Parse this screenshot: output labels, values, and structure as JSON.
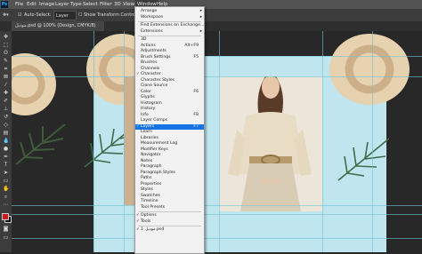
{
  "menubar": {
    "items": [
      "File",
      "Edit",
      "Image",
      "Layer",
      "Type",
      "Select",
      "Filter",
      "3D",
      "View",
      "Window",
      "Help"
    ],
    "active": "Window"
  },
  "options": {
    "auto_select": "Auto-Select:",
    "layer_select": "Layer",
    "show_transform": "Show Transform Controls"
  },
  "document_tab": {
    "title": "موديل.psd @ 100% (Design, CMYK/8)"
  },
  "window_menu": {
    "items": [
      {
        "label": "Arrange",
        "submenu": true
      },
      {
        "label": "Workspace",
        "submenu": true
      },
      {
        "sep": true
      },
      {
        "label": "Find Extensions on Exchange..."
      },
      {
        "label": "Extensions",
        "submenu": true
      },
      {
        "sep": true
      },
      {
        "label": "3D"
      },
      {
        "label": "Actions",
        "shortcut": "Alt+F9"
      },
      {
        "label": "Adjustments"
      },
      {
        "label": "Brush Settings",
        "shortcut": "F5"
      },
      {
        "label": "Brushes"
      },
      {
        "label": "Channels"
      },
      {
        "label": "Character",
        "checked": true
      },
      {
        "label": "Character Styles"
      },
      {
        "label": "Clone Source"
      },
      {
        "label": "Color",
        "shortcut": "F6"
      },
      {
        "label": "Glyphs"
      },
      {
        "label": "Histogram"
      },
      {
        "label": "History"
      },
      {
        "label": "Info",
        "shortcut": "F8"
      },
      {
        "label": "Layer Comps"
      },
      {
        "label": "Layers",
        "shortcut": "F7",
        "checked": true,
        "highlighted": true
      },
      {
        "label": "Learn"
      },
      {
        "label": "Libraries"
      },
      {
        "label": "Measurement Log"
      },
      {
        "label": "Modifier Keys"
      },
      {
        "label": "Navigator"
      },
      {
        "label": "Notes"
      },
      {
        "label": "Paragraph"
      },
      {
        "label": "Paragraph Styles"
      },
      {
        "label": "Paths"
      },
      {
        "label": "Properties"
      },
      {
        "label": "Styles"
      },
      {
        "label": "Swatches"
      },
      {
        "label": "Timeline"
      },
      {
        "label": "Tool Presets"
      },
      {
        "sep": true
      },
      {
        "label": "Options",
        "checked": true
      },
      {
        "label": "Tools",
        "checked": true
      },
      {
        "sep": true
      },
      {
        "label": "موديل.psd",
        "checked": true,
        "prefix": "1"
      }
    ]
  },
  "tools": [
    "move",
    "marquee",
    "lasso",
    "quick-select",
    "crop",
    "frame",
    "eyedropper",
    "healing",
    "brush",
    "stamp",
    "history-brush",
    "eraser",
    "gradient",
    "blur",
    "dodge",
    "pen",
    "type",
    "path-select",
    "rectangle",
    "hand",
    "zoom",
    "more"
  ],
  "colors": {
    "foreground": "#d0161b",
    "background": "#111111",
    "highlight": "#1473e6"
  }
}
